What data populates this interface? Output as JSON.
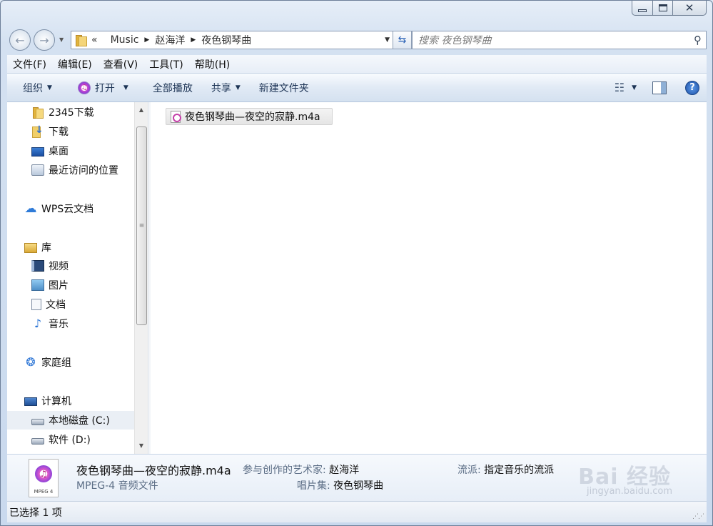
{
  "window": {
    "controls": {
      "minimize": "",
      "maximize": "",
      "close": "✕"
    }
  },
  "address": {
    "overflow": "«",
    "crumbs": [
      "Music",
      "赵海洋",
      "夜色钢琴曲"
    ],
    "search_placeholder": "搜索 夜色钢琴曲"
  },
  "menu": [
    "文件(F)",
    "编辑(E)",
    "查看(V)",
    "工具(T)",
    "帮助(H)"
  ],
  "toolbar": {
    "organize": "组织",
    "open": "打开",
    "play_all": "全部播放",
    "share": "共享",
    "new_folder": "新建文件夹"
  },
  "nav": {
    "items": [
      {
        "label": "2345下载",
        "icon": "folder-icon"
      },
      {
        "label": "下载",
        "icon": "downloads-icon"
      },
      {
        "label": "桌面",
        "icon": "desktop-icon"
      },
      {
        "label": "最近访问的位置",
        "icon": "recent-places-icon"
      },
      {
        "label": "WPS云文档",
        "icon": "cloud-icon"
      },
      {
        "label": "库",
        "icon": "library-icon"
      },
      {
        "label": "视频",
        "icon": "video-icon"
      },
      {
        "label": "图片",
        "icon": "pictures-icon"
      },
      {
        "label": "文档",
        "icon": "documents-icon"
      },
      {
        "label": "音乐",
        "icon": "music-icon"
      },
      {
        "label": "家庭组",
        "icon": "homegroup-icon"
      },
      {
        "label": "计算机",
        "icon": "computer-icon"
      },
      {
        "label": "本地磁盘 (C:)",
        "icon": "drive-icon"
      },
      {
        "label": "软件 (D:)",
        "icon": "drive-icon"
      }
    ]
  },
  "files": [
    {
      "name": "夜色钢琴曲—夜空的寂静.m4a"
    }
  ],
  "details": {
    "name": "夜色钢琴曲—夜空的寂静.m4a",
    "artist_label": "参与创作的艺术家:",
    "artist_value": "赵海洋",
    "genre_label": "流派:",
    "genre_value": "指定音乐的流派",
    "type": "MPEG-4 音频文件",
    "album_label": "唱片集:",
    "album_value": "夜色钢琴曲",
    "icon_caption": "MPEG 4",
    "watermark": "Bai 经验",
    "watermark_sub": "jingyan.baidu.com"
  },
  "status": {
    "text": "已选择 1 项"
  },
  "colors": {
    "accent": "#2a62b6",
    "toolbar_text": "#1e3556",
    "label_text": "#5b6d85"
  }
}
